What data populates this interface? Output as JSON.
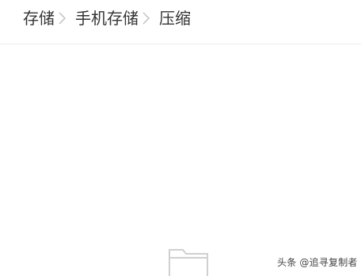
{
  "breadcrumb": {
    "items": [
      {
        "label": "存储"
      },
      {
        "label": "手机存储"
      },
      {
        "label": "压缩"
      }
    ],
    "separator_icon": "chevron-right-icon"
  },
  "empty_state": {
    "icon": "folder-icon"
  },
  "watermark": {
    "text": "头条 @追寻复制者"
  },
  "colors": {
    "background": "#ffffff",
    "breadcrumb_text": "#333333",
    "separator": "#bbbbbb",
    "divider": "#eeeeee",
    "folder_outline": "#d0d0d0"
  }
}
